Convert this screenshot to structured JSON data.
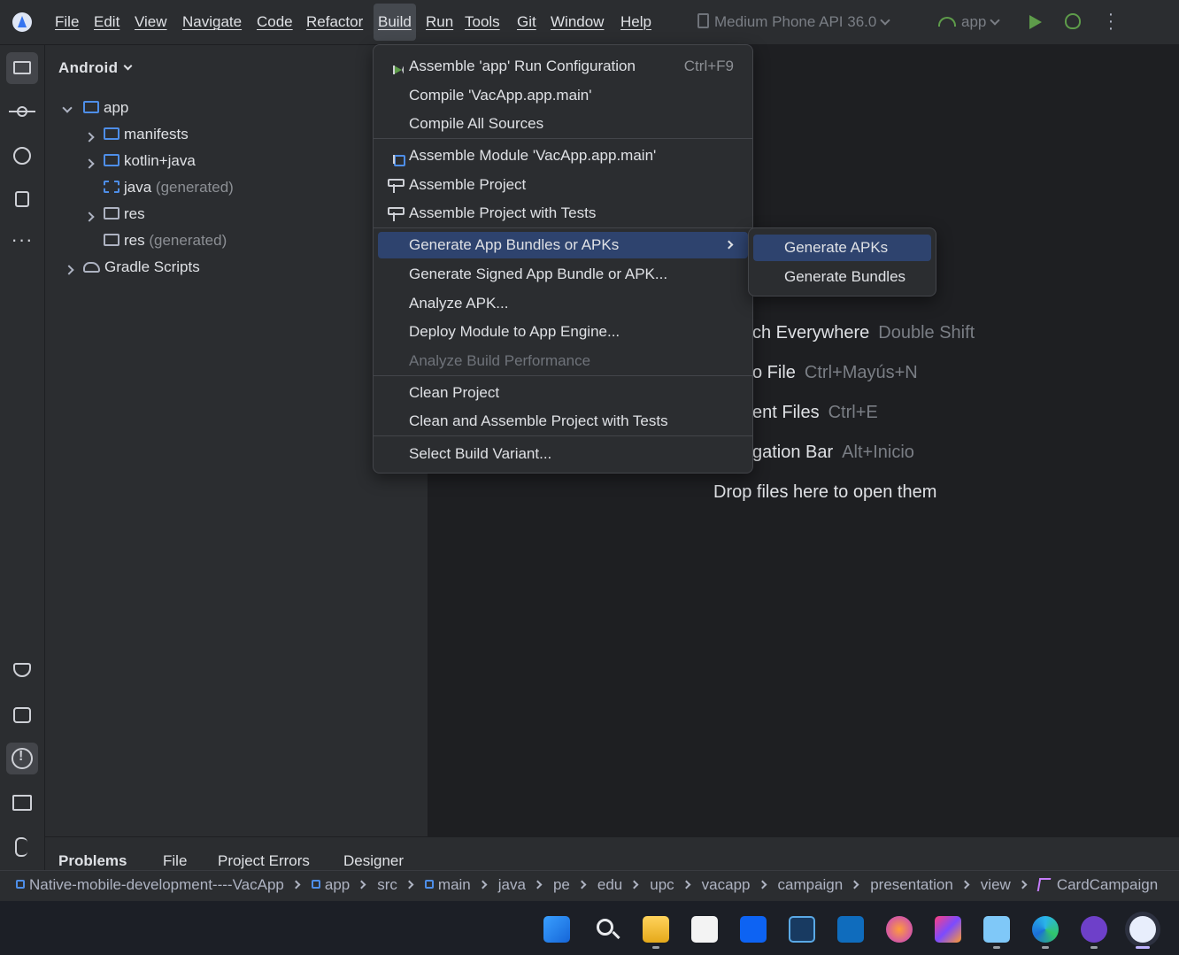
{
  "menubar": {
    "items": [
      "File",
      "Edit",
      "View",
      "Navigate",
      "Code",
      "Refactor",
      "Build",
      "Run",
      "Tools",
      "Git",
      "Window",
      "Help"
    ],
    "open_item": "Build",
    "device": "Medium Phone API 36.0",
    "run_config": "app"
  },
  "project_panel": {
    "view": "Android",
    "tree": [
      {
        "label": "app",
        "suffix": "",
        "expanded": true
      },
      {
        "label": "manifests",
        "suffix": ""
      },
      {
        "label": "kotlin+java",
        "suffix": ""
      },
      {
        "label": "java",
        "suffix": "(generated)"
      },
      {
        "label": "res",
        "suffix": ""
      },
      {
        "label": "res",
        "suffix": "(generated)"
      },
      {
        "label": "Gradle Scripts",
        "suffix": ""
      }
    ]
  },
  "build_menu": {
    "items": [
      {
        "label": "Assemble 'app' Run Configuration",
        "shortcut": "Ctrl+F9",
        "icon": "run-config-icon"
      },
      {
        "label": "Compile 'VacApp.app.main'"
      },
      {
        "label": "Compile All Sources"
      },
      {
        "label": "Assemble Module 'VacApp.app.main'",
        "icon": "module-icon"
      },
      {
        "label": "Assemble Project",
        "icon": "hammer-icon"
      },
      {
        "label": "Assemble Project with Tests",
        "icon": "hammer-icon"
      },
      {
        "label": "Generate App Bundles or APKs",
        "highlighted": true,
        "submenu": true
      },
      {
        "label": "Generate Signed App Bundle or APK..."
      },
      {
        "label": "Analyze APK..."
      },
      {
        "label": "Deploy Module to App Engine..."
      },
      {
        "label": "Analyze Build Performance",
        "disabled": true
      },
      {
        "label": "Clean Project"
      },
      {
        "label": "Clean and Assemble Project with Tests"
      },
      {
        "label": "Select Build Variant..."
      }
    ]
  },
  "submenu": {
    "items": [
      {
        "label": "Generate APKs",
        "highlighted": true
      },
      {
        "label": "Generate Bundles"
      }
    ]
  },
  "editor_hints": [
    {
      "action": "ch Everywhere",
      "shortcut": "Double Shift"
    },
    {
      "action": "o File",
      "shortcut": "Ctrl+Mayús+N"
    },
    {
      "action": "ent Files",
      "shortcut": "Ctrl+E"
    },
    {
      "action": "gation Bar",
      "shortcut": "Alt+Inicio"
    }
  ],
  "drop_hint": "Drop files here to open them",
  "bottom_tabs": [
    "Problems",
    "File",
    "Project Errors",
    "Designer"
  ],
  "breadcrumb": [
    "Native-mobile-development----VacApp",
    "app",
    "src",
    "main",
    "java",
    "pe",
    "edu",
    "upc",
    "vacapp",
    "campaign",
    "presentation",
    "view",
    "CardCampaign"
  ],
  "taskbar": {
    "apps": [
      "windows-start-icon",
      "search-icon",
      "file-explorer-icon",
      "microsoft-store-icon",
      "dropbox-icon",
      "virtualbox-icon",
      "outlook-icon",
      "firefox-developer-icon",
      "jetbrains-toolbox-icon",
      "notepad-icon",
      "edge-icon",
      "github-desktop-icon",
      "android-studio-icon"
    ]
  },
  "colors": {
    "accent": "#3574f0",
    "menu_highlight": "#2e436e",
    "run_green": "#5e9c4a",
    "folder_blue": "#4e8ee8"
  }
}
